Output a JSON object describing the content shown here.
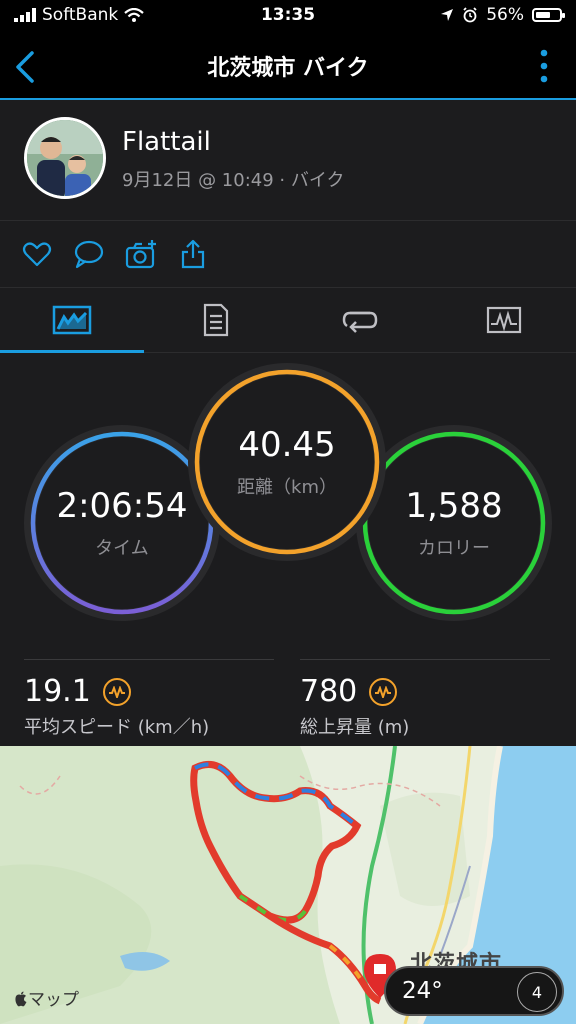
{
  "status_bar": {
    "carrier": "SoftBank",
    "time": "13:35",
    "battery": "56%",
    "battery_level": 0.56
  },
  "nav": {
    "title": "北茨城市 バイク"
  },
  "profile": {
    "name": "Flattail",
    "date": "9月12日 @ 10:49 · バイク"
  },
  "actions": [
    "heart-icon",
    "comment-icon",
    "camera-add-icon",
    "share-icon"
  ],
  "tabs": [
    {
      "name": "summary",
      "icon": "summary-chart-icon",
      "active": true
    },
    {
      "name": "details",
      "icon": "details-list-icon",
      "active": false
    },
    {
      "name": "laps",
      "icon": "laps-loop-icon",
      "active": false
    },
    {
      "name": "charts",
      "icon": "graph-icon",
      "active": false
    }
  ],
  "gauges": {
    "time": {
      "value": "2:06:54",
      "label": "タイム"
    },
    "distance": {
      "value": "40.45",
      "label": "距離（km）"
    },
    "calories": {
      "value": "1,588",
      "label": "カロリー"
    }
  },
  "metrics": {
    "speed": {
      "value": "19.1",
      "label": "平均スピード (km／h)"
    },
    "elevation": {
      "value": "780",
      "label": "総上昇量 (m)"
    }
  },
  "map": {
    "attribution": "マップ",
    "town": "北茨城市",
    "temperature": "24°",
    "compass": "4"
  },
  "colors": {
    "accent": "#1a9de0",
    "time_ring": "#5b8fe0",
    "distance_ring": "#f3a22b",
    "calories_ring": "#2ad13a"
  }
}
